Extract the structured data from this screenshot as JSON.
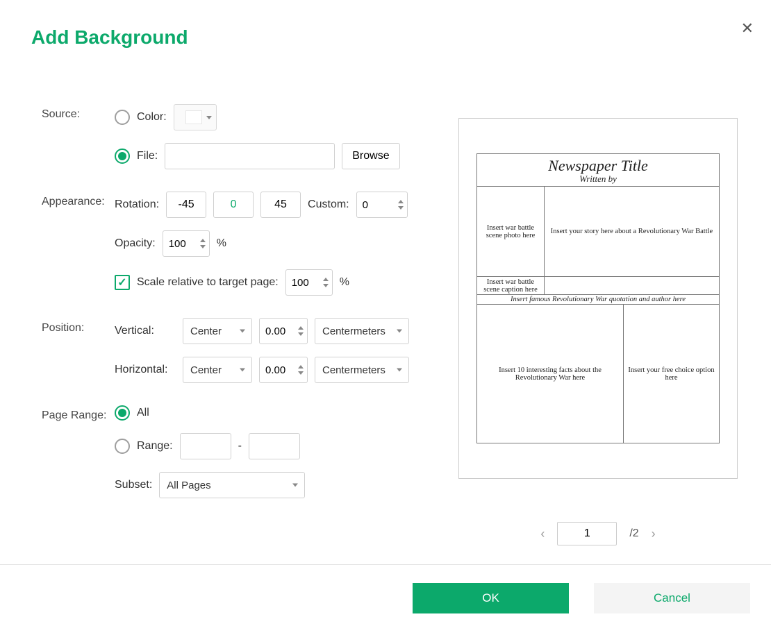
{
  "dialog": {
    "title": "Add Background",
    "ok": "OK",
    "cancel": "Cancel"
  },
  "source": {
    "label": "Source:",
    "color_label": "Color:",
    "file_label": "File:",
    "file_value": "",
    "browse": "Browse",
    "selected": "file"
  },
  "appearance": {
    "label": "Appearance:",
    "rotation_label": "Rotation:",
    "rot_neg45": "-45",
    "rot_0": "0",
    "rot_45": "45",
    "custom_label": "Custom:",
    "custom_value": "0",
    "opacity_label": "Opacity:",
    "opacity_value": "100",
    "percent": "%",
    "scale_label": "Scale relative to target page:",
    "scale_value": "100",
    "scale_checked": true
  },
  "position": {
    "label": "Position:",
    "vertical_label": "Vertical:",
    "vertical_align": "Center",
    "vertical_value": "0.00",
    "vertical_unit": "Centermeters",
    "horizontal_label": "Horizontal:",
    "horizontal_align": "Center",
    "horizontal_value": "0.00",
    "horizontal_unit": "Centermeters"
  },
  "page_range": {
    "label": "Page Range:",
    "all_label": "All",
    "range_label": "Range:",
    "range_from": "",
    "range_to": "",
    "range_dash": "-",
    "subset_label": "Subset:",
    "subset_value": "All Pages",
    "selected": "all"
  },
  "pager": {
    "current": "1",
    "total": "/2"
  },
  "preview": {
    "title": "Newspaper Title",
    "subtitle": "Written by",
    "cell_photo": "Insert war battle scene photo here",
    "cell_story": "Insert your story here about a Revolutionary War Battle",
    "cell_caption": "Insert war battle scene caption here",
    "quote": "Insert famous Revolutionary War quotation and author here",
    "cell_facts": "Insert 10 interesting facts about the Revolutionary War here",
    "cell_free": "Insert your free choice option here"
  }
}
